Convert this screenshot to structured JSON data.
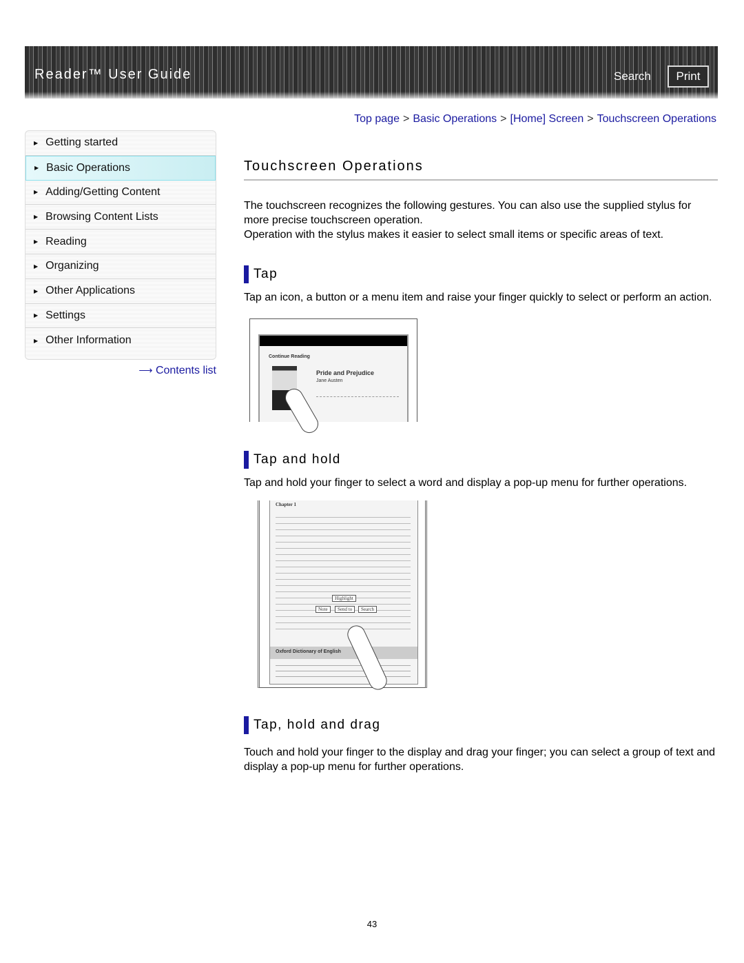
{
  "header": {
    "title": "Reader™ User Guide",
    "search": "Search",
    "print": "Print"
  },
  "breadcrumb": [
    "Top page",
    "Basic Operations",
    "[Home] Screen",
    "Touchscreen Operations"
  ],
  "breadcrumb_sep": ">",
  "sidebar": {
    "items": [
      {
        "label": "Getting started"
      },
      {
        "label": "Basic Operations",
        "active": true
      },
      {
        "label": "Adding/Getting Content"
      },
      {
        "label": "Browsing Content Lists"
      },
      {
        "label": "Reading"
      },
      {
        "label": "Organizing"
      },
      {
        "label": "Other Applications"
      },
      {
        "label": "Settings"
      },
      {
        "label": "Other Information"
      }
    ],
    "contents_link": "Contents list"
  },
  "main": {
    "title": "Touchscreen Operations",
    "intro1": "The touchscreen recognizes the following gestures. You can also use the supplied stylus for more precise touchscreen operation.",
    "intro2": "Operation with the stylus makes it easier to select small items or specific areas of text.",
    "sections": [
      {
        "heading": "Tap",
        "text": "Tap an icon, a button or a menu item and raise your finger quickly to select or perform an action.",
        "figure": {
          "caption": "Continue Reading",
          "book": "Pride and Prejudice",
          "author": "Jane Austen"
        }
      },
      {
        "heading": "Tap and hold",
        "text": "Tap and hold your finger to select a word and display a pop-up menu for further operations.",
        "figure": {
          "chapter": "Chapter 1",
          "menu": [
            "Highlight",
            "Note",
            "Send to",
            "Search"
          ],
          "dictionary": "Oxford Dictionary of English"
        }
      },
      {
        "heading": "Tap, hold and drag",
        "text": "Touch and hold your finger to the display and drag your finger; you can select a group of text and display a pop-up menu for further operations."
      }
    ]
  },
  "page_number": "43",
  "colors": {
    "link": "#1a1aa0",
    "header_bg": "#2e2e2e",
    "active_item": "#c9eef2"
  }
}
